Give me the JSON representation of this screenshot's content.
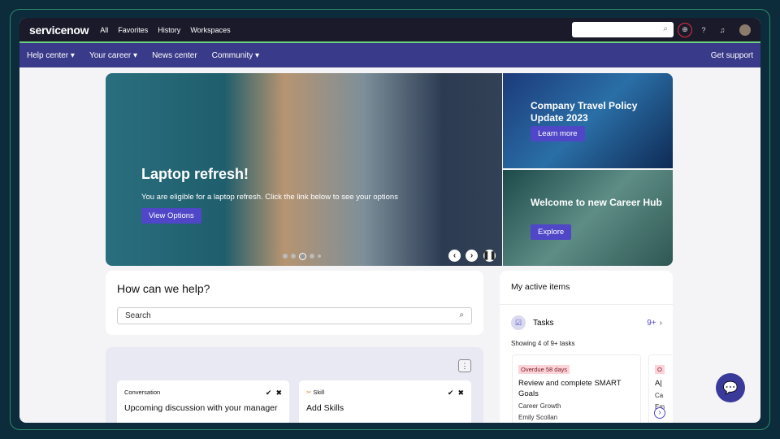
{
  "topbar": {
    "logo": "servicenow",
    "nav": [
      "All",
      "Favorites",
      "History",
      "Workspaces"
    ]
  },
  "subnav": {
    "items": [
      "Help center ▾",
      "Your career ▾",
      "News center",
      "Community ▾"
    ],
    "get_support": "Get support"
  },
  "hero": {
    "title": "Laptop refresh!",
    "subtitle": "You are eligible for a laptop refresh. Click the link below to see your options",
    "button": "View Options"
  },
  "side1": {
    "title": "Company Travel Policy Update 2023",
    "button": "Learn more"
  },
  "side2": {
    "title": "Welcome to new Career Hub",
    "button": "Explore"
  },
  "help": {
    "title": "How can we help?",
    "search_placeholder": "Search"
  },
  "cards": [
    {
      "kind": "Conversation",
      "title": "Upcoming discussion with your manager"
    },
    {
      "kind": "Skill",
      "title": "Add Skills"
    }
  ],
  "active": {
    "title": "My active items",
    "tasks_label": "Tasks",
    "count": "9+",
    "showing": "Showing 4 of 9+ tasks",
    "task_cards": [
      {
        "badge": "Overdue 58 days",
        "title": "Review and complete SMART Goals",
        "category": "Career Growth",
        "person": "Emily Scollan"
      },
      {
        "badge": "O",
        "title": "A|",
        "category": "Ca",
        "person": "Em"
      }
    ]
  }
}
